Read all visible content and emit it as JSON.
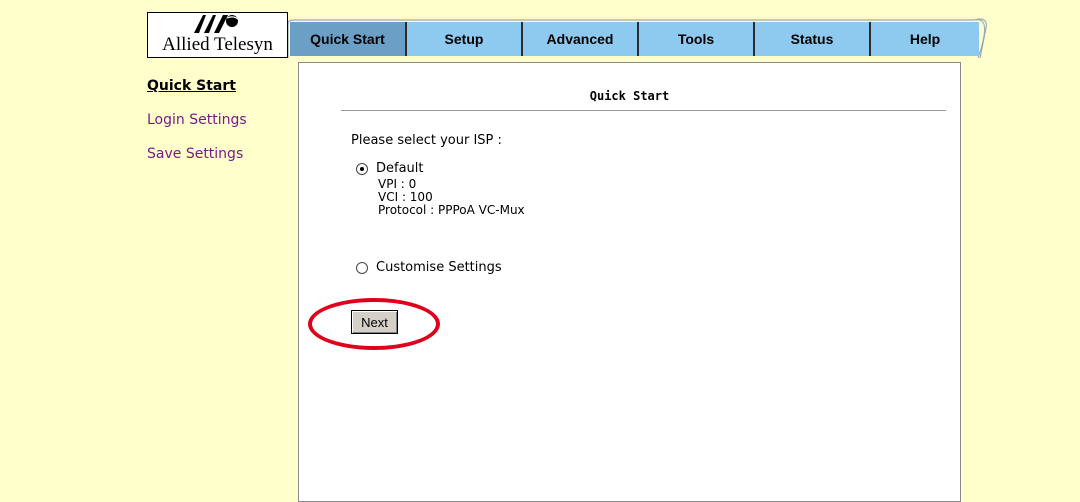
{
  "logo": {
    "brand_text": "Allied Telesyn"
  },
  "tabs": [
    {
      "label": "Quick Start",
      "active": true
    },
    {
      "label": "Setup",
      "active": false
    },
    {
      "label": "Advanced",
      "active": false
    },
    {
      "label": "Tools",
      "active": false
    },
    {
      "label": "Status",
      "active": false
    },
    {
      "label": "Help",
      "active": false
    }
  ],
  "sidebar": {
    "items": [
      {
        "label": "Quick Start",
        "active": true
      },
      {
        "label": "Login Settings",
        "active": false
      },
      {
        "label": "Save Settings",
        "active": false
      }
    ]
  },
  "main": {
    "title": "Quick Start",
    "prompt": "Please select your ISP :",
    "options": [
      {
        "label": "Default",
        "checked": true,
        "details": [
          "VPI : 0",
          "VCI : 100",
          "Protocol : PPPoA VC-Mux"
        ]
      },
      {
        "label": "Customise Settings",
        "checked": false
      }
    ],
    "next_button": "Next"
  },
  "colors": {
    "page_bg": "#ffffcc",
    "tab_bg": "#8ec9ef",
    "tab_active_bg": "#6b9fc6",
    "sidebar_link": "#7a1a8a",
    "highlight": "#e0001b"
  }
}
